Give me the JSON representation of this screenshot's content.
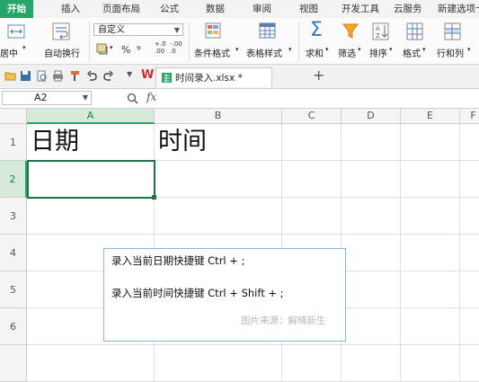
{
  "menu": {
    "tabs": [
      "开始",
      "插入",
      "页面布局",
      "公式",
      "数据",
      "审阅",
      "视图",
      "开发工具",
      "云服务",
      "新建选项卡"
    ]
  },
  "ribbon": {
    "merge_center": "居中",
    "wrap_text": "自动换行",
    "number_format": "自定义",
    "percent": "%",
    "thousands": "⁹",
    "decimal_increase": "+.0\n.00",
    "decimal_decrease": "-.00\n.0",
    "conditional_format": "条件格式",
    "table_style": "表格样式",
    "sum": "求和",
    "filter": "筛选",
    "sort": "排序",
    "format": "格式",
    "rows_cols": "行和列"
  },
  "document": {
    "tab_title": "时间录入.xlsx *",
    "new_tab": "+"
  },
  "formula_bar": {
    "name_box": "A2",
    "fx": "fx",
    "value": ""
  },
  "sheet": {
    "columns": [
      "A",
      "B",
      "C",
      "D",
      "E",
      "F"
    ],
    "rows": [
      "1",
      "2",
      "3",
      "4",
      "5",
      "6"
    ],
    "A1": "日期",
    "B1": "时间",
    "selected_cell": "A2"
  },
  "note": {
    "line1": "录入当前日期快捷键   Ctrl + ;",
    "line2": "录入当前时间快捷键  Ctrl + Shift + ;",
    "source": "图片来源：解晴新生"
  },
  "colors": {
    "accent": "#25a568",
    "selection": "#217346",
    "note_border": "#8fb5d6"
  }
}
